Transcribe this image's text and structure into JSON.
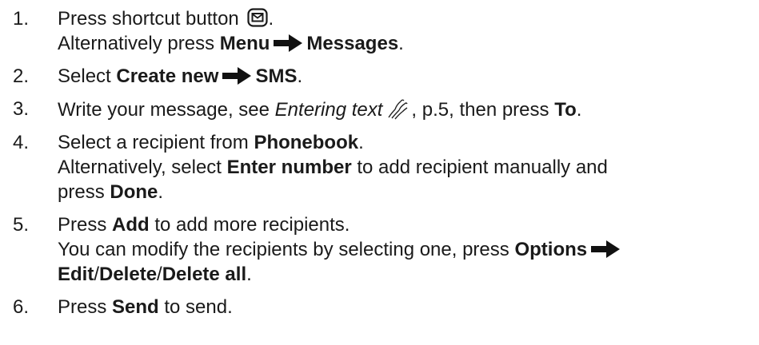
{
  "steps": [
    {
      "number": "1.",
      "lines": [
        [
          {
            "t": "Press shortcut button "
          },
          {
            "icon": "envelope-key-icon"
          },
          {
            "t": "."
          }
        ],
        [
          {
            "t": "Alternatively press "
          },
          {
            "b": "Menu"
          },
          {
            "icon": "right-arrow-icon"
          },
          {
            "b": "Messages"
          },
          {
            "t": "."
          }
        ]
      ]
    },
    {
      "number": "2.",
      "lines": [
        [
          {
            "t": "Select "
          },
          {
            "b": "Create new"
          },
          {
            "icon": "right-arrow-icon"
          },
          {
            "b": "SMS"
          },
          {
            "t": "."
          }
        ]
      ]
    },
    {
      "number": "3.",
      "lines": [
        [
          {
            "t": "Write your message, see "
          },
          {
            "i": "Entering text"
          },
          {
            "icon": "hand-writing-icon"
          },
          {
            "t": ", p.5, then press "
          },
          {
            "b": "To"
          },
          {
            "t": "."
          }
        ]
      ]
    },
    {
      "number": "4.",
      "lines": [
        [
          {
            "t": "Select a recipient from "
          },
          {
            "b": "Phonebook"
          },
          {
            "t": "."
          }
        ],
        [
          {
            "t": "Alternatively, select "
          },
          {
            "b": "Enter number"
          },
          {
            "t": " to add recipient manually and"
          }
        ],
        [
          {
            "t": "press "
          },
          {
            "b": "Done"
          },
          {
            "t": "."
          }
        ]
      ]
    },
    {
      "number": "5.",
      "lines": [
        [
          {
            "t": "Press "
          },
          {
            "b": "Add"
          },
          {
            "t": " to add more recipients."
          }
        ],
        [
          {
            "t": "You can modify the recipients by selecting one, press "
          },
          {
            "b": "Options"
          },
          {
            "icon": "right-arrow-icon"
          }
        ],
        [
          {
            "b": "Edit"
          },
          {
            "t": "/"
          },
          {
            "b": "Delete"
          },
          {
            "t": "/"
          },
          {
            "b": "Delete all"
          },
          {
            "t": "."
          }
        ]
      ]
    },
    {
      "number": "6.",
      "lines": [
        [
          {
            "t": "Press "
          },
          {
            "b": "Send"
          },
          {
            "t": " to send."
          }
        ]
      ]
    }
  ]
}
